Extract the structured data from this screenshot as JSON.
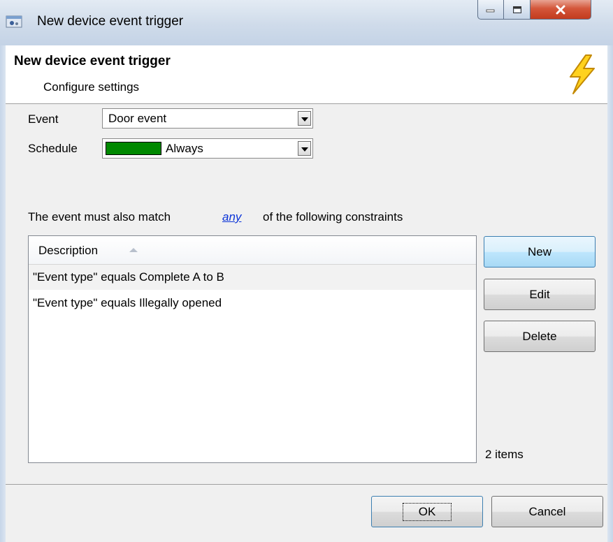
{
  "window": {
    "title": "New device event trigger"
  },
  "header": {
    "title": "New device event trigger",
    "subtitle": "Configure settings"
  },
  "form": {
    "event_label": "Event",
    "event_value": "Door event",
    "schedule_label": "Schedule",
    "schedule_value": "Always",
    "schedule_color": "#008800"
  },
  "constraints": {
    "prefix": "The event must also match",
    "match_mode": "any",
    "suffix": "of the following constraints",
    "column_header": "Description",
    "rows": [
      "\"Event type\" equals Complete A to B",
      "\"Event type\" equals Illegally opened"
    ],
    "count_label": "2 items"
  },
  "buttons": {
    "new": "New",
    "edit": "Edit",
    "delete": "Delete",
    "ok": "OK",
    "cancel": "Cancel"
  },
  "icons": {
    "app": "trigger-app-icon",
    "header": "lightning-bolt-icon"
  }
}
